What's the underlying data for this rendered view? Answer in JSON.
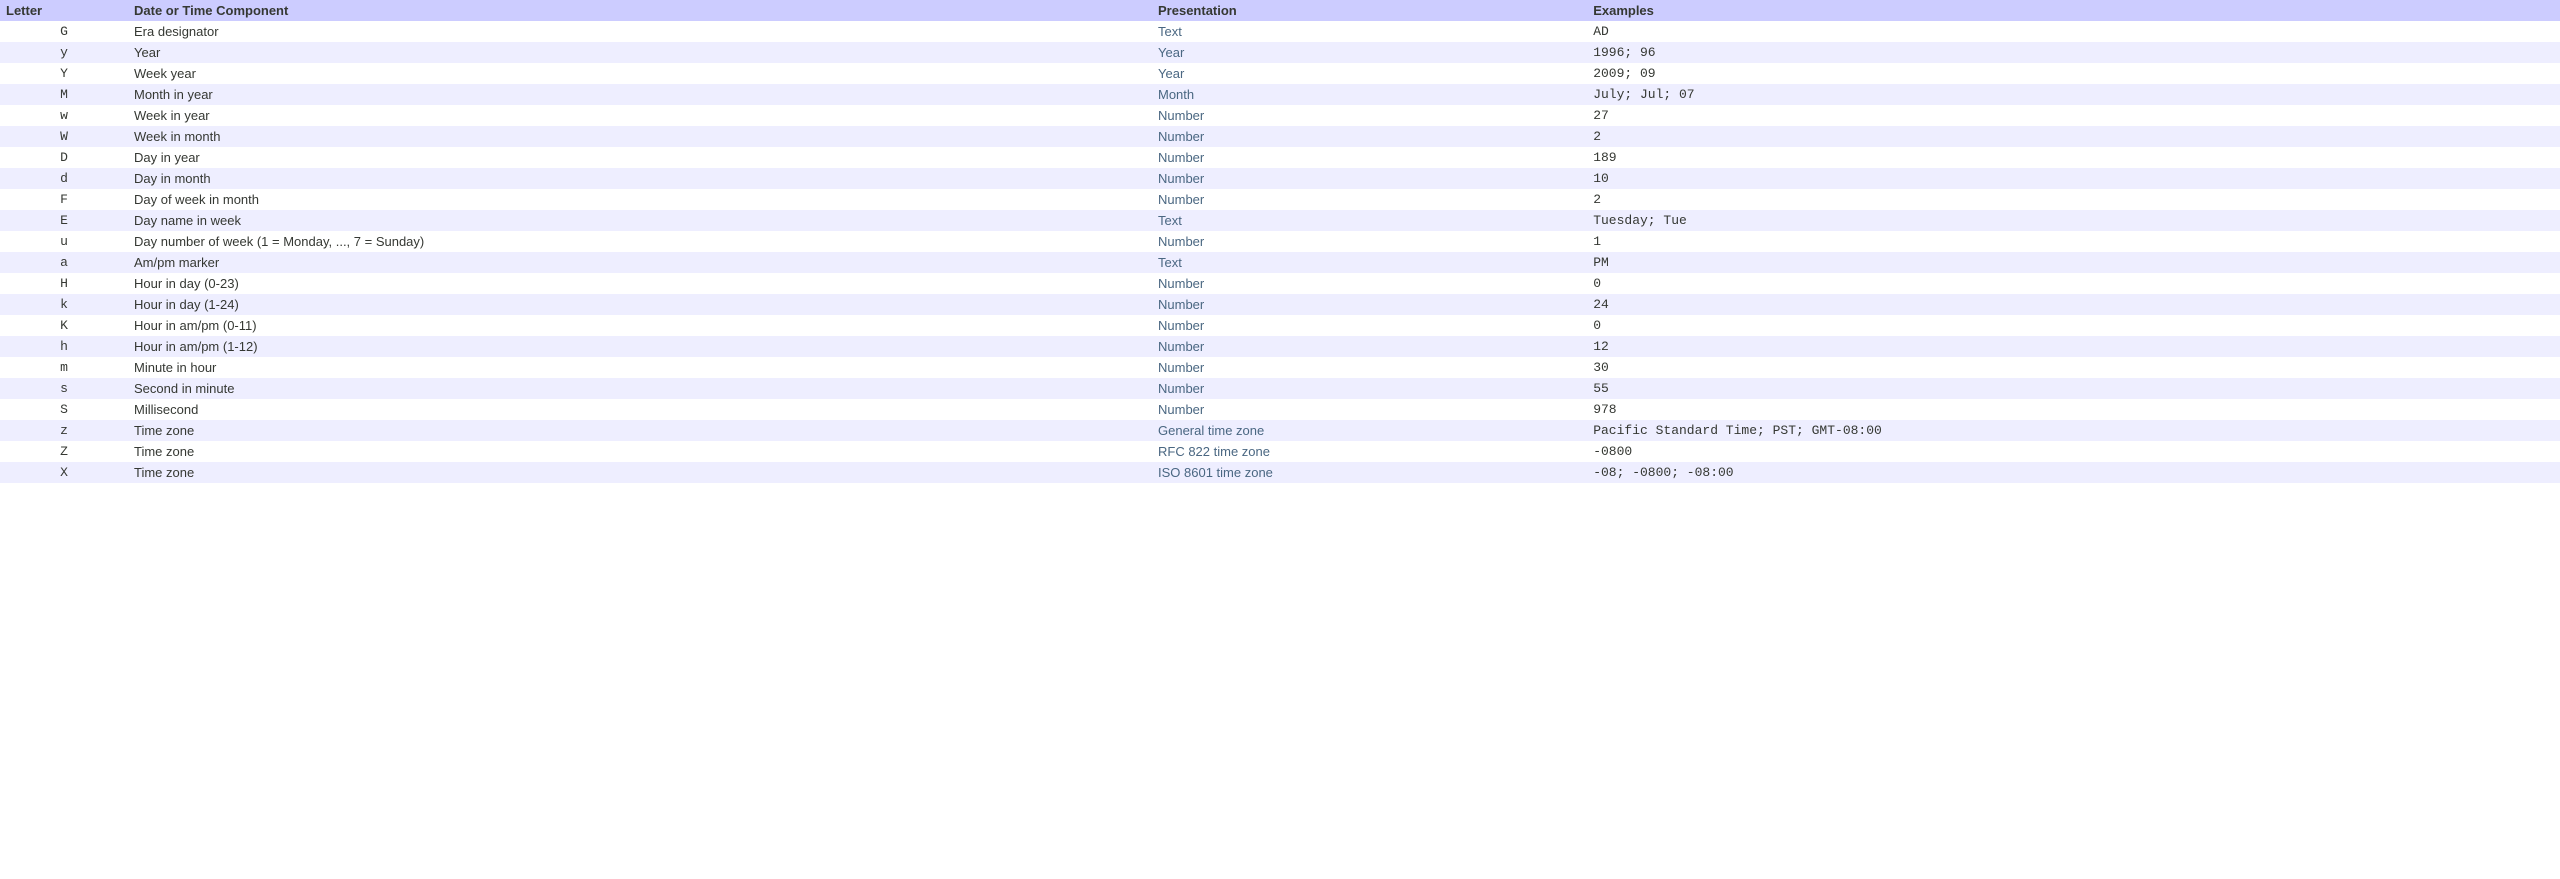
{
  "headers": {
    "letter": "Letter",
    "component": "Date or Time Component",
    "presentation": "Presentation",
    "examples": "Examples"
  },
  "rows": [
    {
      "letter": "G",
      "component": "Era designator",
      "presentation": "Text",
      "examples": "AD"
    },
    {
      "letter": "y",
      "component": "Year",
      "presentation": "Year",
      "examples": "1996; 96"
    },
    {
      "letter": "Y",
      "component": "Week year",
      "presentation": "Year",
      "examples": "2009; 09"
    },
    {
      "letter": "M",
      "component": "Month in year",
      "presentation": "Month",
      "examples": "July; Jul; 07"
    },
    {
      "letter": "w",
      "component": "Week in year",
      "presentation": "Number",
      "examples": "27"
    },
    {
      "letter": "W",
      "component": "Week in month",
      "presentation": "Number",
      "examples": "2"
    },
    {
      "letter": "D",
      "component": "Day in year",
      "presentation": "Number",
      "examples": "189"
    },
    {
      "letter": "d",
      "component": "Day in month",
      "presentation": "Number",
      "examples": "10"
    },
    {
      "letter": "F",
      "component": "Day of week in month",
      "presentation": "Number",
      "examples": "2"
    },
    {
      "letter": "E",
      "component": "Day name in week",
      "presentation": "Text",
      "examples": "Tuesday; Tue"
    },
    {
      "letter": "u",
      "component": "Day number of week (1 = Monday, ..., 7 = Sunday)",
      "presentation": "Number",
      "examples": "1"
    },
    {
      "letter": "a",
      "component": "Am/pm marker",
      "presentation": "Text",
      "examples": "PM"
    },
    {
      "letter": "H",
      "component": "Hour in day (0-23)",
      "presentation": "Number",
      "examples": "0"
    },
    {
      "letter": "k",
      "component": "Hour in day (1-24)",
      "presentation": "Number",
      "examples": "24"
    },
    {
      "letter": "K",
      "component": "Hour in am/pm (0-11)",
      "presentation": "Number",
      "examples": "0"
    },
    {
      "letter": "h",
      "component": "Hour in am/pm (1-12)",
      "presentation": "Number",
      "examples": "12"
    },
    {
      "letter": "m",
      "component": "Minute in hour",
      "presentation": "Number",
      "examples": "30"
    },
    {
      "letter": "s",
      "component": "Second in minute",
      "presentation": "Number",
      "examples": "55"
    },
    {
      "letter": "S",
      "component": "Millisecond",
      "presentation": "Number",
      "examples": "978"
    },
    {
      "letter": "z",
      "component": "Time zone",
      "presentation": "General time zone",
      "examples": "Pacific Standard Time; PST; GMT-08:00"
    },
    {
      "letter": "Z",
      "component": "Time zone",
      "presentation": "RFC 822 time zone",
      "examples": "-0800"
    },
    {
      "letter": "X",
      "component": "Time zone",
      "presentation": "ISO 8601 time zone",
      "examples": "-08; -0800; -08:00"
    }
  ]
}
